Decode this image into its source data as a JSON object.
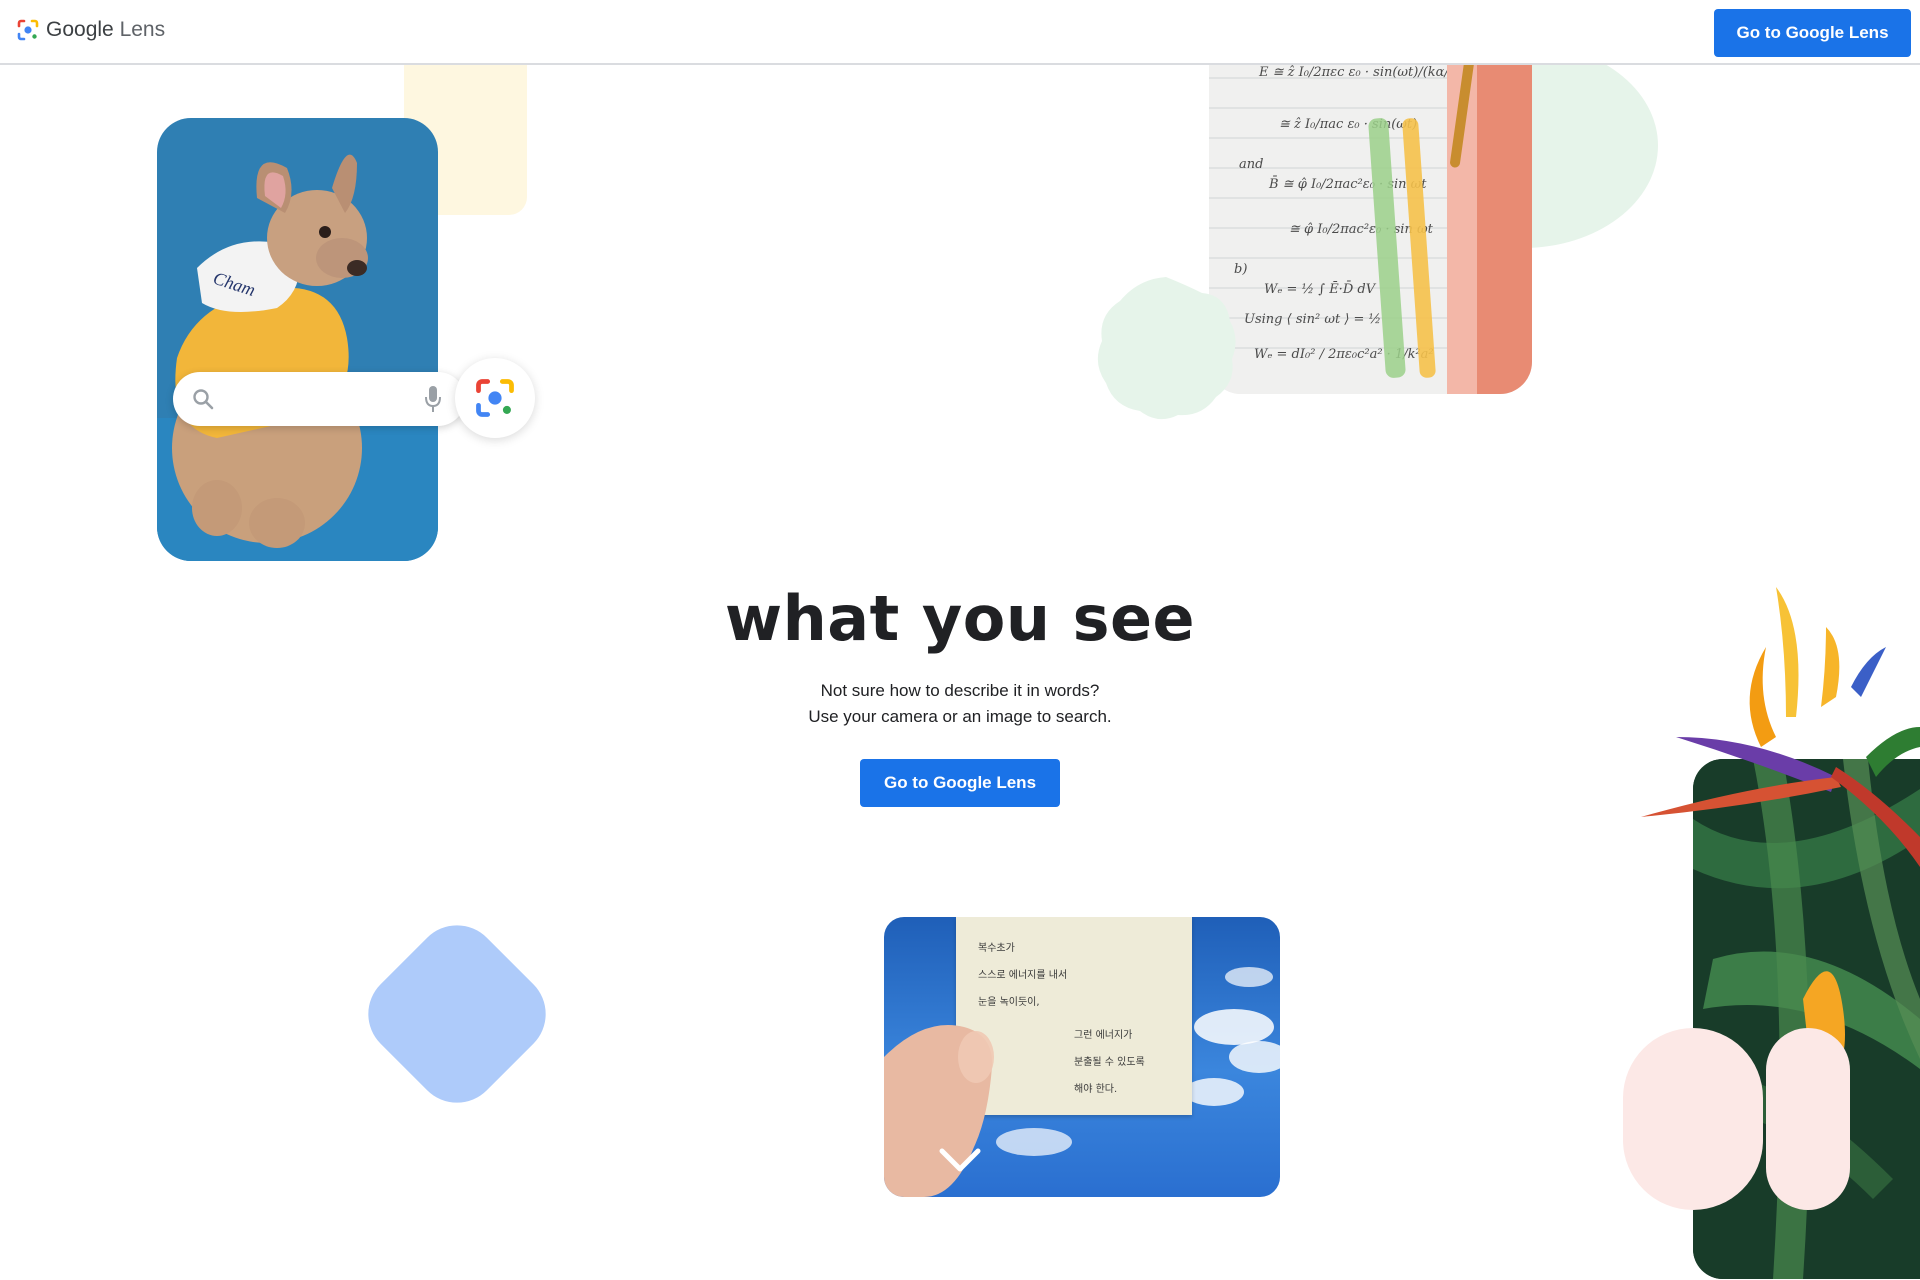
{
  "header": {
    "brand_google": "Google",
    "brand_product": "Lens",
    "cta_label": "Go to Google Lens"
  },
  "hero": {
    "title": "what you see",
    "subtitle_line1": "Not sure how to describe it in words?",
    "subtitle_line2": "Use your camera or an image to search.",
    "cta_label": "Go to Google Lens"
  },
  "icons": {
    "search": "search-icon",
    "mic": "mic-icon",
    "lens": "lens-camera-icon",
    "chevron": "chevron-down-icon"
  },
  "note_card": {
    "lines": [
      "복수초가",
      "스스로 에너지를 내서",
      "눈을 녹이듯이,",
      "그런 에너지가",
      "분출될 수 있도록",
      "해야 한다."
    ]
  },
  "colors": {
    "primary": "#1a73e8",
    "mint": "#e6f4ea",
    "cream": "#fef7e0",
    "light_blue": "#aecbfa",
    "pink": "#fce8e6"
  }
}
